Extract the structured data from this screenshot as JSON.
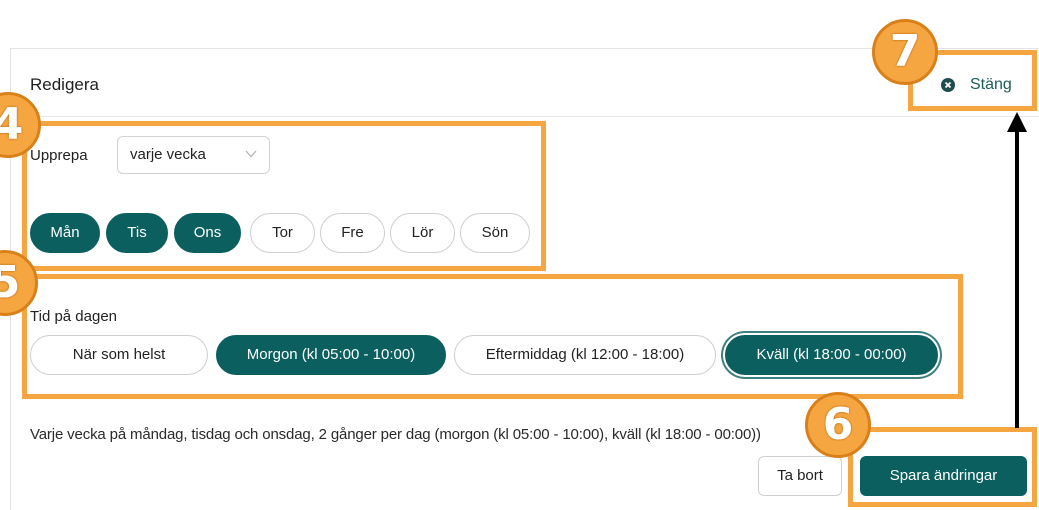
{
  "header": {
    "title": "Redigera",
    "close_label": "Stäng",
    "close_icon": "close-circle-icon"
  },
  "repeat": {
    "label": "Upprepa",
    "selected": "varje vecka",
    "chevron_icon": "chevron-down-icon"
  },
  "days": [
    {
      "label": "Mån",
      "selected": true
    },
    {
      "label": "Tis",
      "selected": true
    },
    {
      "label": "Ons",
      "selected": true
    },
    {
      "label": "Tor",
      "selected": false
    },
    {
      "label": "Fre",
      "selected": false
    },
    {
      "label": "Lör",
      "selected": false
    },
    {
      "label": "Sön",
      "selected": false
    }
  ],
  "time_of_day": {
    "label": "Tid på dagen",
    "options": [
      {
        "label": "När som helst",
        "selected": false,
        "focused": false
      },
      {
        "label": "Morgon (kl 05:00 - 10:00)",
        "selected": true,
        "focused": false
      },
      {
        "label": "Eftermiddag (kl 12:00 - 18:00)",
        "selected": false,
        "focused": false
      },
      {
        "label": "Kväll (kl 18:00 - 00:00)",
        "selected": true,
        "focused": true
      }
    ]
  },
  "summary": "Varje vecka på måndag, tisdag och onsdag, 2 gånger per dag (morgon (kl 05:00 - 10:00), kväll (kl 18:00 - 00:00))",
  "actions": {
    "delete_label": "Ta bort",
    "save_label": "Spara ändringar"
  },
  "annotations": {
    "badge_4": "4",
    "badge_5": "5",
    "badge_6": "6",
    "badge_7": "7",
    "arrow_icon": "arrow-up-icon"
  },
  "colors": {
    "accent": "#0b5f5f",
    "annotation": "#f6a640",
    "text": "#222222",
    "border": "#d3d3d3"
  }
}
